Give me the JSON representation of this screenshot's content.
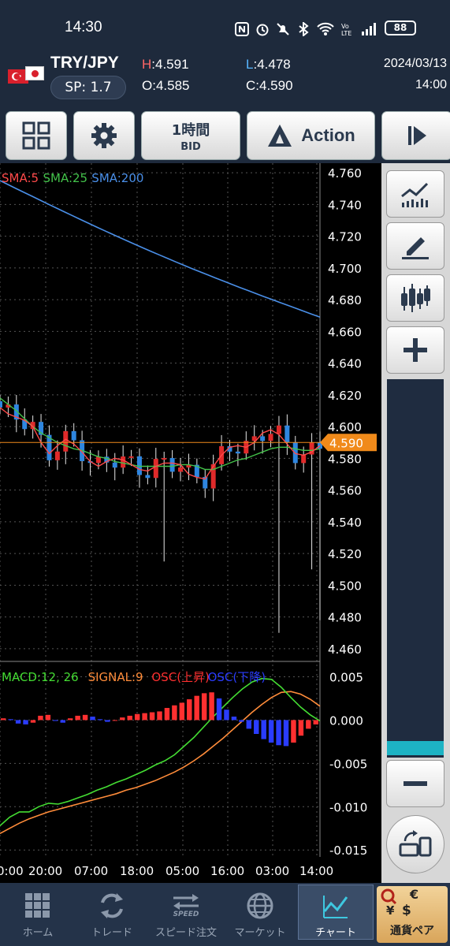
{
  "status": {
    "time": "14:30",
    "battery": "88",
    "icons": [
      "nfc-icon",
      "alarm-icon",
      "mute-icon",
      "bluetooth-icon",
      "wifi-icon",
      "volte-icon",
      "signal-icon"
    ]
  },
  "quote": {
    "pair": "TRY/JPY",
    "spread": "SP: 1.7",
    "high_key": "H",
    "high_val": ":4.591",
    "low_key": "L",
    "low_val": ":4.478",
    "open": "O:4.585",
    "close": "C:4.590",
    "date": "2024/03/13",
    "hour": "14:00"
  },
  "toolbar": {
    "timeframe_l1": "1時間",
    "timeframe_l2": "BID",
    "action_label": "Action"
  },
  "chart_data": {
    "type": "line",
    "price_axis": {
      "ticks": [
        "4.760",
        "4.740",
        "4.720",
        "4.700",
        "4.680",
        "4.660",
        "4.640",
        "4.620",
        "4.600",
        "4.580",
        "4.560",
        "4.540",
        "4.520",
        "4.500",
        "4.480",
        "4.460"
      ]
    },
    "current_price": "4.590",
    "legend": [
      {
        "label": "SMA:5",
        "color": "#ff4a4a"
      },
      {
        "label": "SMA:25",
        "color": "#43c24a"
      },
      {
        "label": "SMA:200",
        "color": "#4a8fe8"
      }
    ],
    "macd_legend": [
      {
        "label": "MACD:12, 26",
        "color": "#44dd33"
      },
      {
        "label": "SIGNAL:9",
        "color": "#ff8c3a"
      },
      {
        "label": "OSC(上昇)",
        "color": "#ff3030"
      },
      {
        "label": "OSC(下降)",
        "color": "#2a3cff"
      }
    ],
    "macd_axis": {
      "ticks": [
        "0.005",
        "0.000",
        "-0.005",
        "-0.010",
        "-0.015"
      ]
    },
    "time_axis": [
      "0:00",
      "20:00",
      "07:00",
      "18:00",
      "05:00",
      "16:00",
      "03:00",
      "14:00"
    ],
    "sma200": {
      "start": 4.755,
      "end": 4.669
    },
    "price_range": {
      "min": 4.455,
      "max": 4.766
    },
    "sma5": [
      4.612,
      4.608,
      4.606,
      4.604,
      4.6,
      4.59,
      4.583,
      4.588,
      4.592,
      4.589,
      4.584,
      4.578,
      4.575,
      4.578,
      4.58,
      4.579,
      4.576,
      4.573,
      4.572,
      4.575,
      4.577,
      4.577,
      4.576,
      4.57,
      4.568,
      4.567,
      4.575,
      4.582,
      4.587,
      4.588,
      4.587,
      4.59,
      4.596,
      4.598,
      4.595,
      4.589,
      4.583,
      4.582,
      4.584,
      4.588
    ],
    "sma25": [
      4.618,
      4.614,
      4.61,
      4.605,
      4.6,
      4.596,
      4.593,
      4.59,
      4.588,
      4.586,
      4.585,
      4.583,
      4.581,
      4.58,
      4.578,
      4.577,
      4.576,
      4.575,
      4.575,
      4.575,
      4.575,
      4.575,
      4.576,
      4.576,
      4.575,
      4.573,
      4.573,
      4.575,
      4.577,
      4.579,
      4.58,
      4.582,
      4.584,
      4.586,
      4.587,
      4.587,
      4.586,
      4.585,
      4.585,
      4.586
    ],
    "macd": [
      -0.0122,
      -0.0112,
      -0.0106,
      -0.0106,
      -0.01,
      -0.0096,
      -0.0097,
      -0.0094,
      -0.009,
      -0.0086,
      -0.0081,
      -0.0077,
      -0.0072,
      -0.0068,
      -0.0063,
      -0.0058,
      -0.0052,
      -0.0047,
      -0.004,
      -0.003,
      -0.002,
      -0.0008,
      0.0004,
      0.0015,
      0.0026,
      0.0036,
      0.0044,
      0.0048,
      0.0047,
      0.0038,
      0.0026,
      0.0015,
      0.0006,
      -0.0001
    ],
    "signal": [
      -0.0131,
      -0.0125,
      -0.0119,
      -0.0114,
      -0.011,
      -0.0106,
      -0.0103,
      -0.01,
      -0.0097,
      -0.0094,
      -0.0091,
      -0.0088,
      -0.0085,
      -0.0081,
      -0.0078,
      -0.0074,
      -0.007,
      -0.0065,
      -0.006,
      -0.0054,
      -0.0047,
      -0.0039,
      -0.003,
      -0.0021,
      -0.0011,
      -0.0001,
      0.0009,
      0.0018,
      0.0026,
      0.0032,
      0.0033,
      0.003,
      0.0024,
      0.0016
    ],
    "osc": [
      0.0002,
      0.0001,
      -0.0004,
      -0.0005,
      -0.0003,
      0.0005,
      0.0006,
      -0.0001,
      -0.0003,
      0.0002,
      0.0005,
      0.0006,
      0.0004,
      0.0001,
      -0.0002,
      0.0,
      0.0003,
      0.0005,
      0.0007,
      0.0008,
      0.0009,
      0.001,
      0.0014,
      0.0017,
      0.002,
      0.0024,
      0.0028,
      0.0031,
      0.0032,
      0.0025,
      0.0012,
      0.0004,
      -0.0002,
      -0.001,
      -0.0016,
      -0.0022,
      -0.0026,
      -0.0029,
      -0.003,
      -0.0026,
      -0.0018,
      -0.001,
      -0.0005
    ]
  },
  "nav": {
    "home": "ホーム",
    "trade": "トレード",
    "speed": "スピード注文",
    "speed_badge": "SPEED",
    "market": "マーケット",
    "chart": "チャート",
    "currency": "通貨ペア"
  },
  "colors": {
    "bg": "#1e2a3c",
    "accent": "#f08a1a",
    "zoom_thumb": "#1db3c4"
  }
}
